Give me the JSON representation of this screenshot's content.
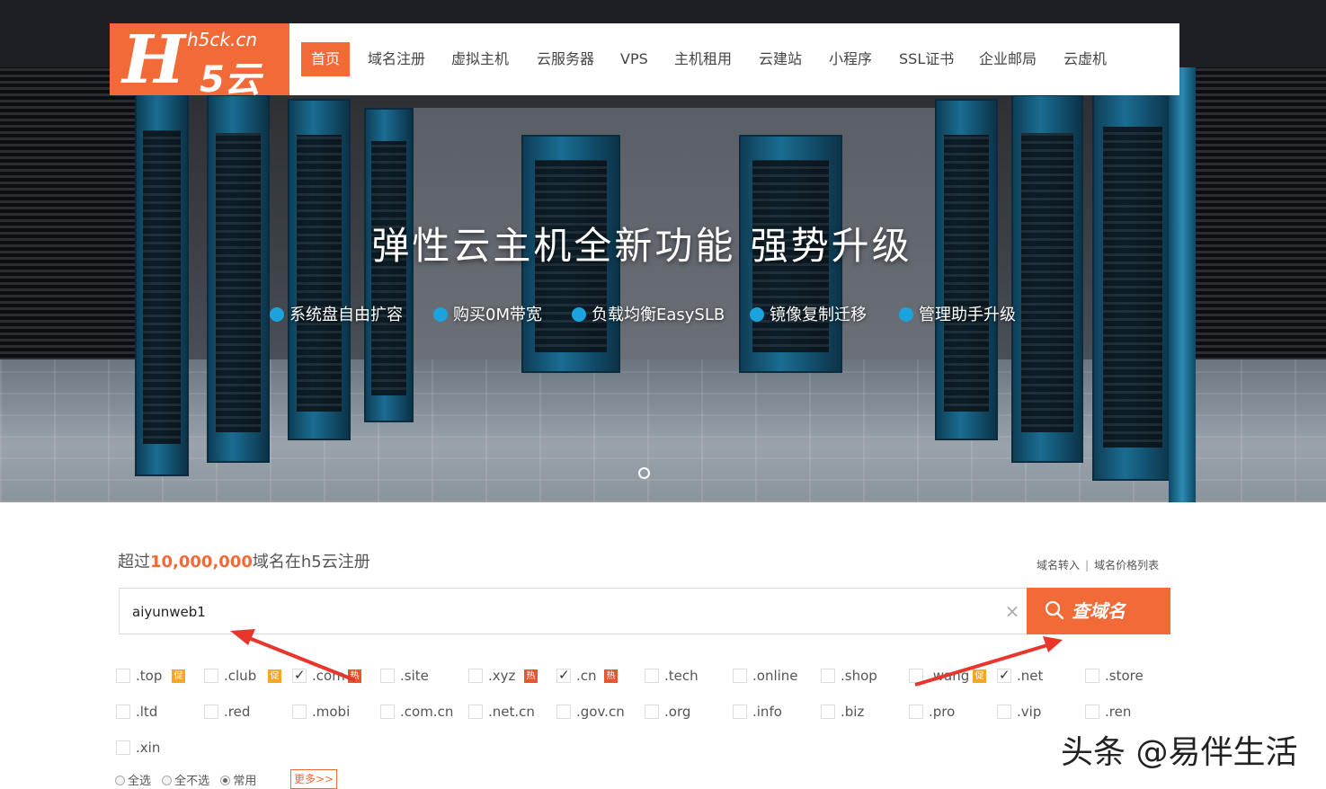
{
  "logo": {
    "big": "H",
    "domain": "h5ck.cn",
    "yun": "5云"
  },
  "nav": {
    "items": [
      {
        "label": "首页",
        "active": true
      },
      {
        "label": "域名注册"
      },
      {
        "label": "虚拟主机"
      },
      {
        "label": "云服务器"
      },
      {
        "label": "VPS"
      },
      {
        "label": "主机租用"
      },
      {
        "label": "云建站"
      },
      {
        "label": "小程序"
      },
      {
        "label": "SSL证书"
      },
      {
        "label": "企业邮局"
      },
      {
        "label": "云虚机"
      }
    ]
  },
  "hero": {
    "title": "弹性云主机全新功能  强势升级",
    "features": [
      "系统盘自由扩容",
      "购买0M带宽",
      "负载均衡EasySLB",
      "镜像复制迁移",
      "管理助手升级"
    ],
    "accent_color": "#1aa3dc"
  },
  "domain_search": {
    "stat_prefix": "超过",
    "stat_number": "10,000,000",
    "stat_suffix": "域名在h5云注册",
    "link_transfer": "域名转入",
    "link_separator": "|",
    "link_prices": "域名价格列表",
    "input_value": "aiyunweb1",
    "clear_icon": "×",
    "button_label": "查域名",
    "brand_color": "#f26a37"
  },
  "tlds": [
    {
      "name": ".top",
      "checked": false,
      "badge": "促"
    },
    {
      "name": ".club",
      "checked": false,
      "badge": "促"
    },
    {
      "name": ".com",
      "checked": true,
      "badge": "热"
    },
    {
      "name": ".site",
      "checked": false
    },
    {
      "name": ".xyz",
      "checked": false,
      "badge": "热"
    },
    {
      "name": ".cn",
      "checked": true,
      "badge": "热"
    },
    {
      "name": ".tech",
      "checked": false
    },
    {
      "name": ".online",
      "checked": false
    },
    {
      "name": ".shop",
      "checked": false
    },
    {
      "name": ".wang",
      "checked": false,
      "badge": "促"
    },
    {
      "name": ".net",
      "checked": true
    },
    {
      "name": ".store",
      "checked": false
    },
    {
      "name": ".ltd",
      "checked": false
    },
    {
      "name": ".red",
      "checked": false
    },
    {
      "name": ".mobi",
      "checked": false
    },
    {
      "name": ".com.cn",
      "checked": false
    },
    {
      "name": ".net.cn",
      "checked": false
    },
    {
      "name": ".gov.cn",
      "checked": false
    },
    {
      "name": ".org",
      "checked": false
    },
    {
      "name": ".info",
      "checked": false
    },
    {
      "name": ".biz",
      "checked": false
    },
    {
      "name": ".pro",
      "checked": false
    },
    {
      "name": ".vip",
      "checked": false
    },
    {
      "name": ".ren",
      "checked": false
    },
    {
      "name": ".xin",
      "checked": false
    }
  ],
  "selection": {
    "select_all": "全选",
    "select_none": "全不选",
    "common": "常用",
    "selected": "常用",
    "more": "更多>>"
  },
  "watermark": "头条 @易伴生活"
}
